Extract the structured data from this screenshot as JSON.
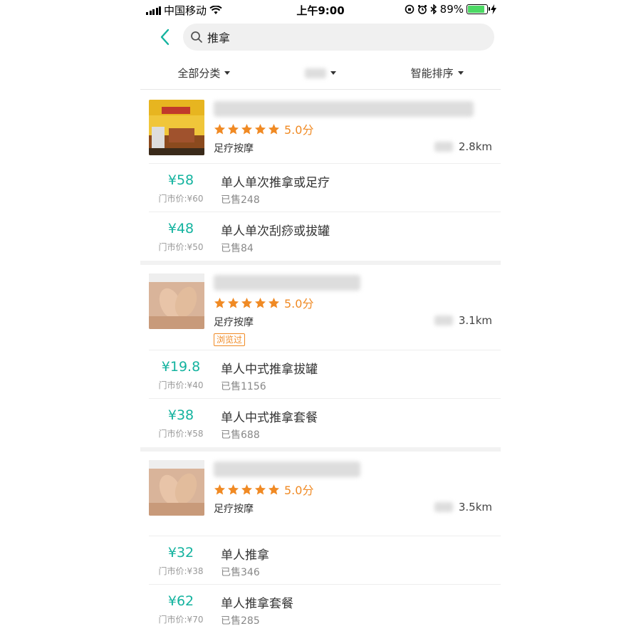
{
  "status_bar": {
    "carrier": "中国移动",
    "time": "上午9:00",
    "battery_percent": "89%",
    "battery_level": 0.89
  },
  "search": {
    "query": "推拿"
  },
  "filters": {
    "category": "全部分类",
    "sort": "智能排序"
  },
  "shops": [
    {
      "score": "5.0分",
      "stars": 5,
      "category": "足疗按摩",
      "distance": "2.8km",
      "viewed": "",
      "deals": [
        {
          "price": "¥58",
          "original": "门市价:¥60",
          "title": "单人单次推拿或足疗",
          "sold": "已售248"
        },
        {
          "price": "¥48",
          "original": "门市价:¥50",
          "title": "单人单次刮痧或拔罐",
          "sold": "已售84"
        }
      ]
    },
    {
      "score": "5.0分",
      "stars": 5,
      "category": "足疗按摩",
      "distance": "3.1km",
      "viewed": "浏览过",
      "deals": [
        {
          "price": "¥19.8",
          "original": "门市价:¥40",
          "title": "单人中式推拿拔罐",
          "sold": "已售1156"
        },
        {
          "price": "¥38",
          "original": "门市价:¥58",
          "title": "单人中式推拿套餐",
          "sold": "已售688"
        }
      ]
    },
    {
      "score": "5.0分",
      "stars": 5,
      "category": "足疗按摩",
      "distance": "3.5km",
      "viewed": "",
      "deals": [
        {
          "price": "¥32",
          "original": "门市价:¥38",
          "title": "单人推拿",
          "sold": "已售346"
        },
        {
          "price": "¥62",
          "original": "门市价:¥70",
          "title": "单人推拿套餐",
          "sold": "已售285"
        }
      ]
    }
  ],
  "colors": {
    "accent": "#14b39f",
    "star": "#f08a24",
    "battery": "#4cd964"
  },
  "icons": [
    "signal-icon",
    "wifi-icon",
    "lock-rotation-icon",
    "alarm-icon",
    "bluetooth-icon",
    "battery-icon",
    "charging-icon",
    "back-chevron-icon",
    "search-icon",
    "caret-down-icon",
    "star-icon"
  ]
}
